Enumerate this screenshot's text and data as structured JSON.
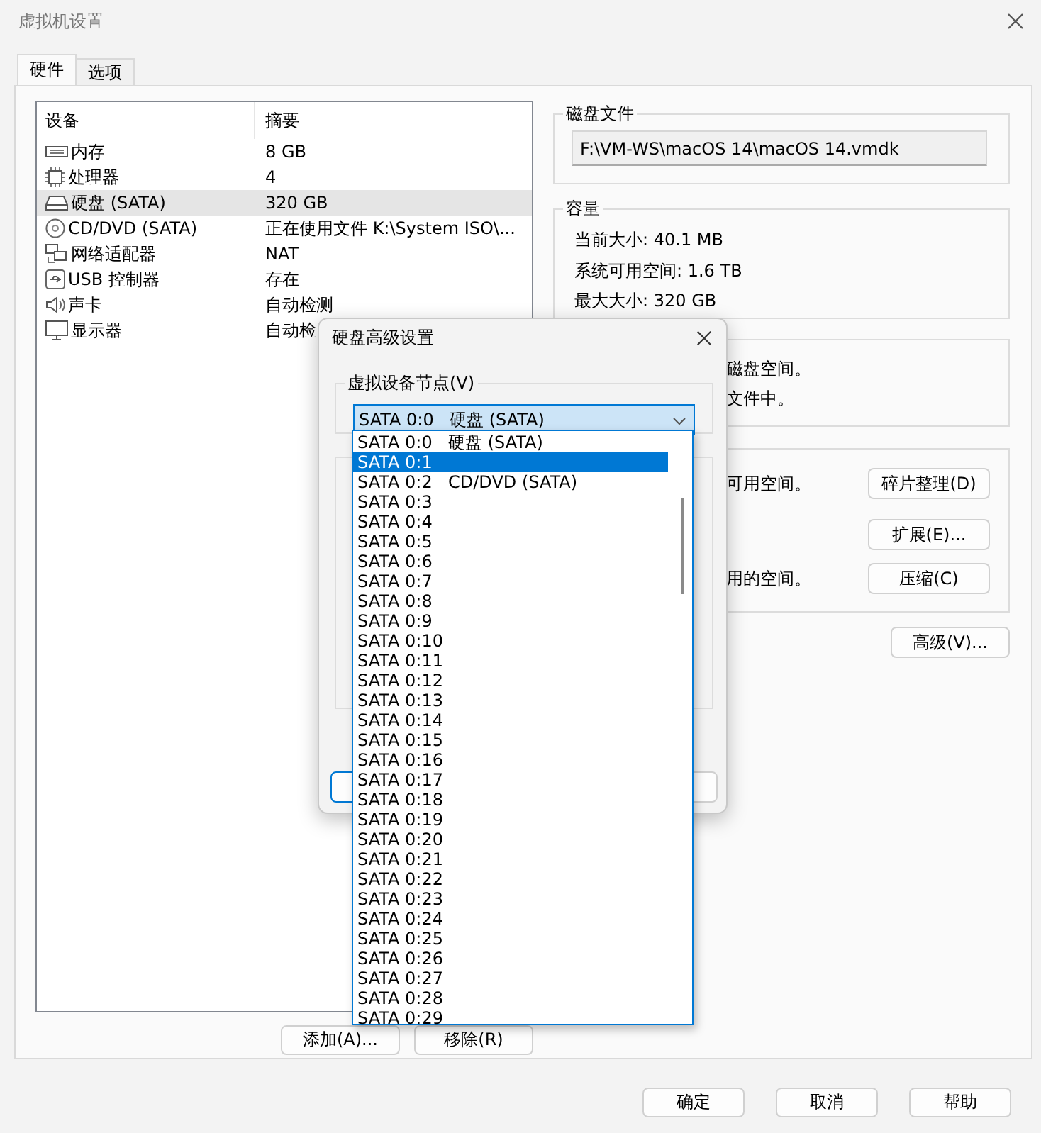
{
  "window": {
    "title": "虚拟机设置"
  },
  "tabs": [
    {
      "label": "硬件",
      "selected": true
    },
    {
      "label": "选项",
      "selected": false
    }
  ],
  "devices": {
    "columns": [
      "设备",
      "摘要"
    ],
    "rows": [
      {
        "kind": "memory",
        "name": "内存",
        "summary": "8 GB",
        "selected": false
      },
      {
        "kind": "cpu",
        "name": "处理器",
        "summary": "4",
        "selected": false
      },
      {
        "kind": "disk",
        "name": "硬盘 (SATA)",
        "summary": "320 GB",
        "selected": true
      },
      {
        "kind": "cdrom",
        "name": "CD/DVD (SATA)",
        "summary": "正在使用文件 K:\\System ISO\\...",
        "selected": false
      },
      {
        "kind": "network",
        "name": "网络适配器",
        "summary": "NAT",
        "selected": false
      },
      {
        "kind": "usb",
        "name": "USB 控制器",
        "summary": "存在",
        "selected": false
      },
      {
        "kind": "sound",
        "name": "声卡",
        "summary": "自动检测",
        "selected": false
      },
      {
        "kind": "display",
        "name": "显示器",
        "summary": "自动检",
        "selected": false
      }
    ]
  },
  "device_buttons": [
    "添加(A)...",
    "移除(R)"
  ],
  "disk_file": {
    "title": "磁盘文件",
    "value": "F:\\VM-WS\\macOS 14\\macOS 14.vmdk"
  },
  "capacity": {
    "title": "容量",
    "lines": [
      "当前大小: 40.1 MB",
      "系统可用空间: 1.6 TB",
      "最大大小: 320 GB"
    ]
  },
  "mapping": {
    "lines": [
      "磁盘空间。",
      "文件中。"
    ]
  },
  "maintenance": {
    "rows": [
      {
        "text": "可用空间。",
        "button": "碎片整理(D)"
      },
      {
        "button": "扩展(E)..."
      },
      {
        "text": "用的空间。",
        "button": "压缩(C)"
      }
    ]
  },
  "advanced_button": "高级(V)...",
  "footer_buttons": [
    "确定",
    "取消",
    "帮助"
  ],
  "dialog": {
    "title": "硬盘高级设置",
    "node_group": {
      "title": "虚拟设备节点(V)",
      "combo": {
        "node": "SATA 0:0",
        "device": "硬盘 (SATA)"
      },
      "options": [
        {
          "node": "SATA 0:0",
          "device": "硬盘 (SATA)",
          "selected": false
        },
        {
          "node": "SATA 0:1",
          "selected": true
        },
        {
          "node": "SATA 0:2",
          "device": "CD/DVD (SATA)",
          "selected": false
        },
        {
          "node": "SATA 0:3",
          "selected": false
        },
        {
          "node": "SATA 0:4",
          "selected": false
        },
        {
          "node": "SATA 0:5",
          "selected": false
        },
        {
          "node": "SATA 0:6",
          "selected": false
        },
        {
          "node": "SATA 0:7",
          "selected": false
        },
        {
          "node": "SATA 0:8",
          "selected": false
        },
        {
          "node": "SATA 0:9",
          "selected": false
        },
        {
          "node": "SATA 0:10",
          "selected": false
        },
        {
          "node": "SATA 0:11",
          "selected": false
        },
        {
          "node": "SATA 0:12",
          "selected": false
        },
        {
          "node": "SATA 0:13",
          "selected": false
        },
        {
          "node": "SATA 0:14",
          "selected": false
        },
        {
          "node": "SATA 0:15",
          "selected": false
        },
        {
          "node": "SATA 0:16",
          "selected": false
        },
        {
          "node": "SATA 0:17",
          "selected": false
        },
        {
          "node": "SATA 0:18",
          "selected": false
        },
        {
          "node": "SATA 0:19",
          "selected": false
        },
        {
          "node": "SATA 0:20",
          "selected": false
        },
        {
          "node": "SATA 0:21",
          "selected": false
        },
        {
          "node": "SATA 0:22",
          "selected": false
        },
        {
          "node": "SATA 0:23",
          "selected": false
        },
        {
          "node": "SATA 0:24",
          "selected": false
        },
        {
          "node": "SATA 0:25",
          "selected": false
        },
        {
          "node": "SATA 0:26",
          "selected": false
        },
        {
          "node": "SATA 0:27",
          "selected": false
        },
        {
          "node": "SATA 0:28",
          "selected": false
        },
        {
          "node": "SATA 0:29",
          "selected": false
        }
      ]
    }
  }
}
